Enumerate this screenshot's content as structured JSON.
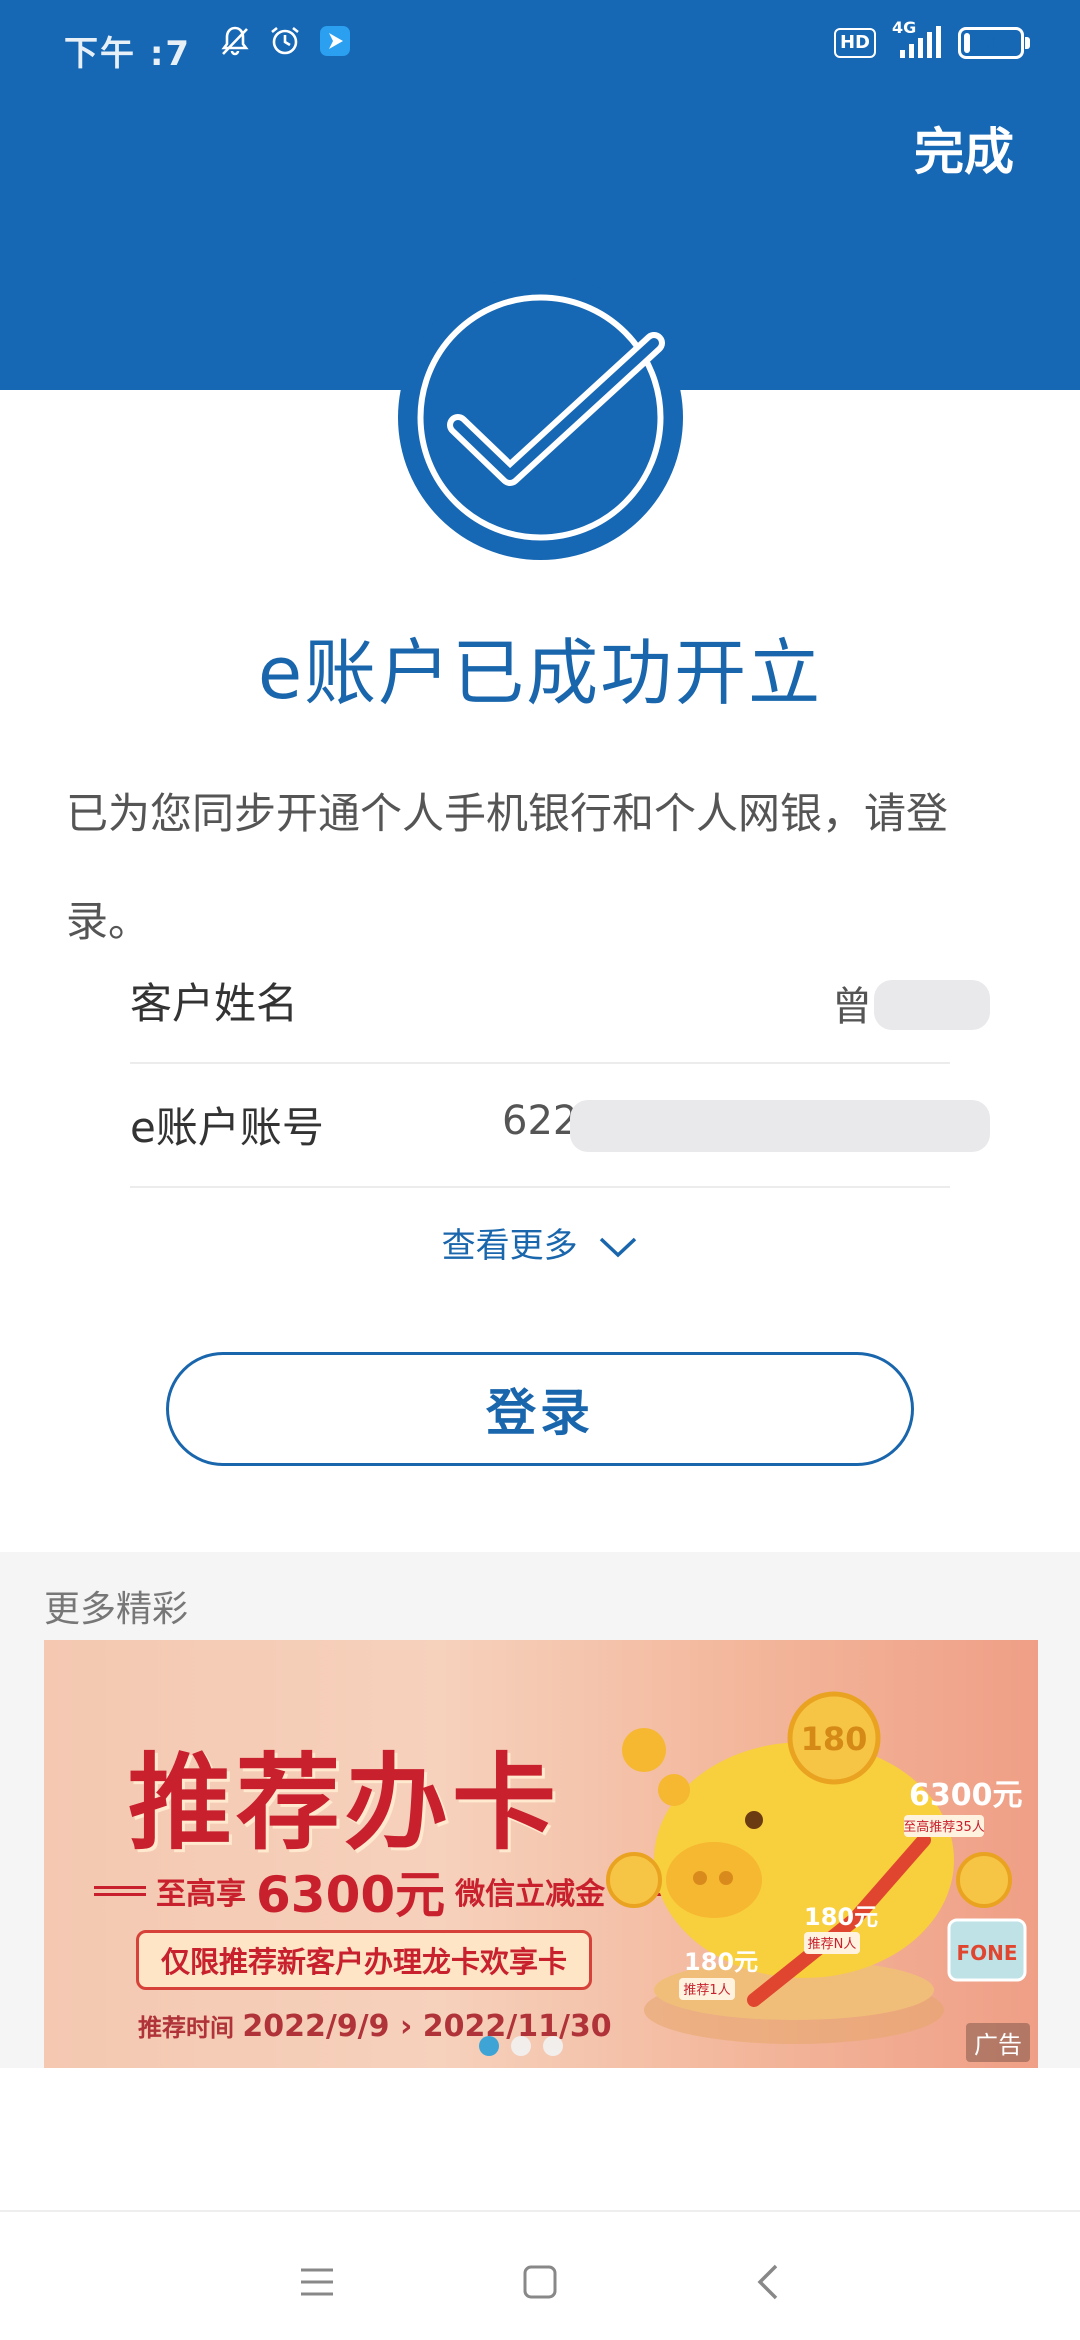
{
  "status_bar": {
    "time": "下午 :7",
    "network": "4G",
    "hd": "HD",
    "battery_text": "1",
    "battery_level": 0.12
  },
  "header": {
    "done_label": "完成"
  },
  "success": {
    "title": "e账户已成功开立",
    "description": "已为您同步开通个人手机银行和个人网银，请登录。"
  },
  "info": {
    "rows": [
      {
        "label": "客户姓名",
        "value": "曾"
      },
      {
        "label": "e账户账号",
        "value": "622"
      }
    ],
    "see_more_label": "查看更多"
  },
  "login": {
    "label": "登录"
  },
  "more": {
    "title": "更多精彩",
    "banner": {
      "headline": "推荐办卡",
      "line1_prefix": "至高享",
      "line1_amount": "6300元",
      "line1_suffix": "微信立减金",
      "line2": "仅限推荐新客户办理龙卡欢享卡",
      "line3_prefix": "推荐时间",
      "line3_dates": "2022/9/9 › 2022/11/30",
      "coin_label_1": "180",
      "coin_label_2": "6300元",
      "coin_label_3": "180元",
      "coin_label_4": "180元",
      "tag_1": "推荐1人",
      "tag_2": "推荐N人",
      "tag_3": "至高推荐35人",
      "card_text": "FONE",
      "ad_label": "广告",
      "active_dot": 0,
      "dot_count": 3
    }
  },
  "colors": {
    "primary_blue": "#1667b4",
    "text_blue": "#1a66ad",
    "banner_red": "#c8202d"
  }
}
